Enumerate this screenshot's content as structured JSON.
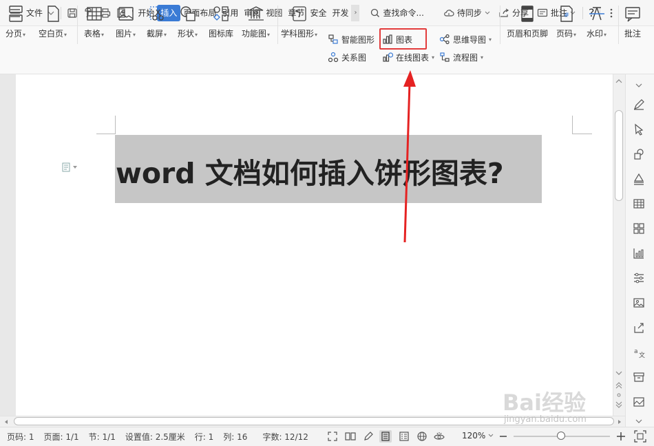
{
  "menubar": {
    "file_menu": "文件",
    "tabs": [
      {
        "label": "开始"
      },
      {
        "label": "插入",
        "active": true
      },
      {
        "label": "页面布局"
      },
      {
        "label": "引用"
      },
      {
        "label": "审阅"
      },
      {
        "label": "视图"
      },
      {
        "label": "章节"
      },
      {
        "label": "安全"
      },
      {
        "label": "开发"
      }
    ],
    "search_label": "查找命令...",
    "sync_label": "待同步",
    "share_label": "分享",
    "comment_label": "批注",
    "help": "?",
    "colors": {
      "active_tab": "#3a7bd5"
    }
  },
  "ribbon": {
    "page_break": "分页",
    "blank_page": "空白页",
    "table": "表格",
    "picture": "图片",
    "screenshot": "截屏",
    "shape": "形状",
    "icon_library": "图标库",
    "function_chart": "功能图",
    "subject_shape": "学科图形",
    "smart_art": "智能图形",
    "relation_chart": "关系图",
    "chart": "图表",
    "online_chart": "在线图表",
    "mind_map": "思维导图",
    "flowchart": "流程图",
    "header_footer": "页眉和页脚",
    "page_number": "页码",
    "watermark": "水印",
    "comment": "批注",
    "highlight_color": "#e23a3a"
  },
  "document": {
    "heading": "word 文档如何插入饼形图表?"
  },
  "statusbar": {
    "page_num": "页码: 1",
    "page_count": "页面: 1/1",
    "section": "节: 1/1",
    "setting_value": "设置值: 2.5厘米",
    "row": "行: 1",
    "column": "列: 16",
    "word_count": "字数: 12/12",
    "zoom": "120%",
    "zoom_level": 0.49
  },
  "watermark": {
    "brand": "Bai经验",
    "url": "jingyan.baidu.com"
  }
}
